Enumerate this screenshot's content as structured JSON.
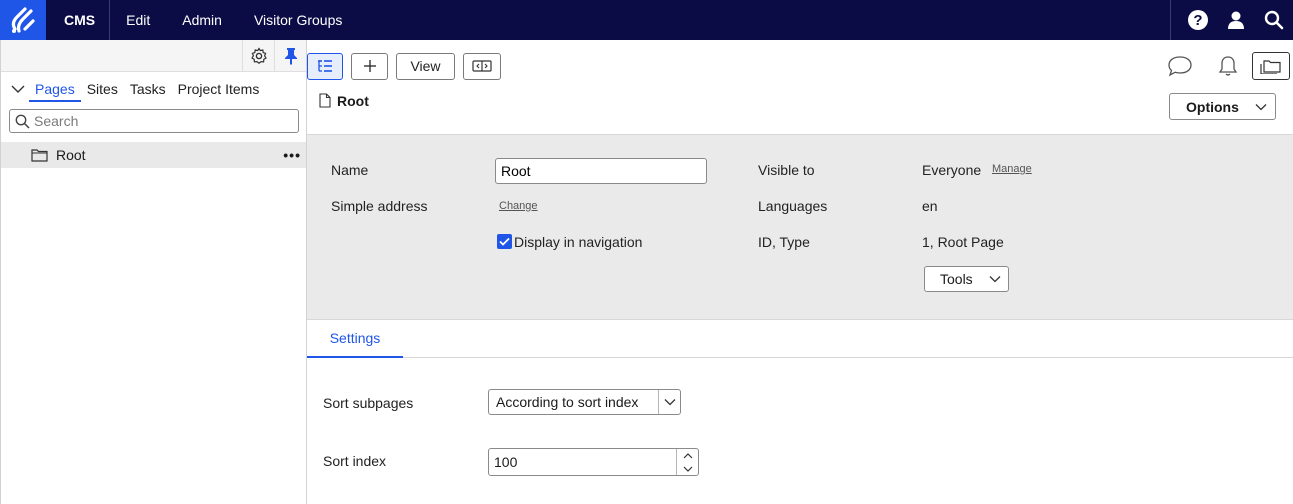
{
  "topbar": {
    "nav": [
      "CMS",
      "Edit",
      "Admin",
      "Visitor Groups"
    ],
    "icons": [
      "help-icon",
      "user-icon",
      "search-icon"
    ],
    "background": "#0b0b45",
    "accent": "#1f56e8"
  },
  "left_pane": {
    "tabs": [
      "Pages",
      "Sites",
      "Tasks",
      "Project Items"
    ],
    "active_tab": "Pages",
    "search_placeholder": "Search",
    "tree": [
      {
        "label": "Root",
        "more": "•••"
      }
    ]
  },
  "toolbar": {
    "view_label": "View"
  },
  "page": {
    "title": "Root",
    "options_label": "Options"
  },
  "properties": {
    "name_label": "Name",
    "name_value": "Root",
    "simple_address_label": "Simple address",
    "change_link": "Change",
    "display_in_nav_label": "Display in navigation",
    "display_in_nav_checked": true,
    "visible_to_label": "Visible to",
    "visible_to_value": "Everyone",
    "manage_link": "Manage",
    "languages_label": "Languages",
    "languages_value": "en",
    "id_type_label": "ID, Type",
    "id_type_value": "1, Root Page",
    "tools_label": "Tools"
  },
  "settings": {
    "tab_label": "Settings",
    "sort_subpages_label": "Sort subpages",
    "sort_subpages_value": "According to sort index",
    "sort_index_label": "Sort index",
    "sort_index_value": "100"
  }
}
